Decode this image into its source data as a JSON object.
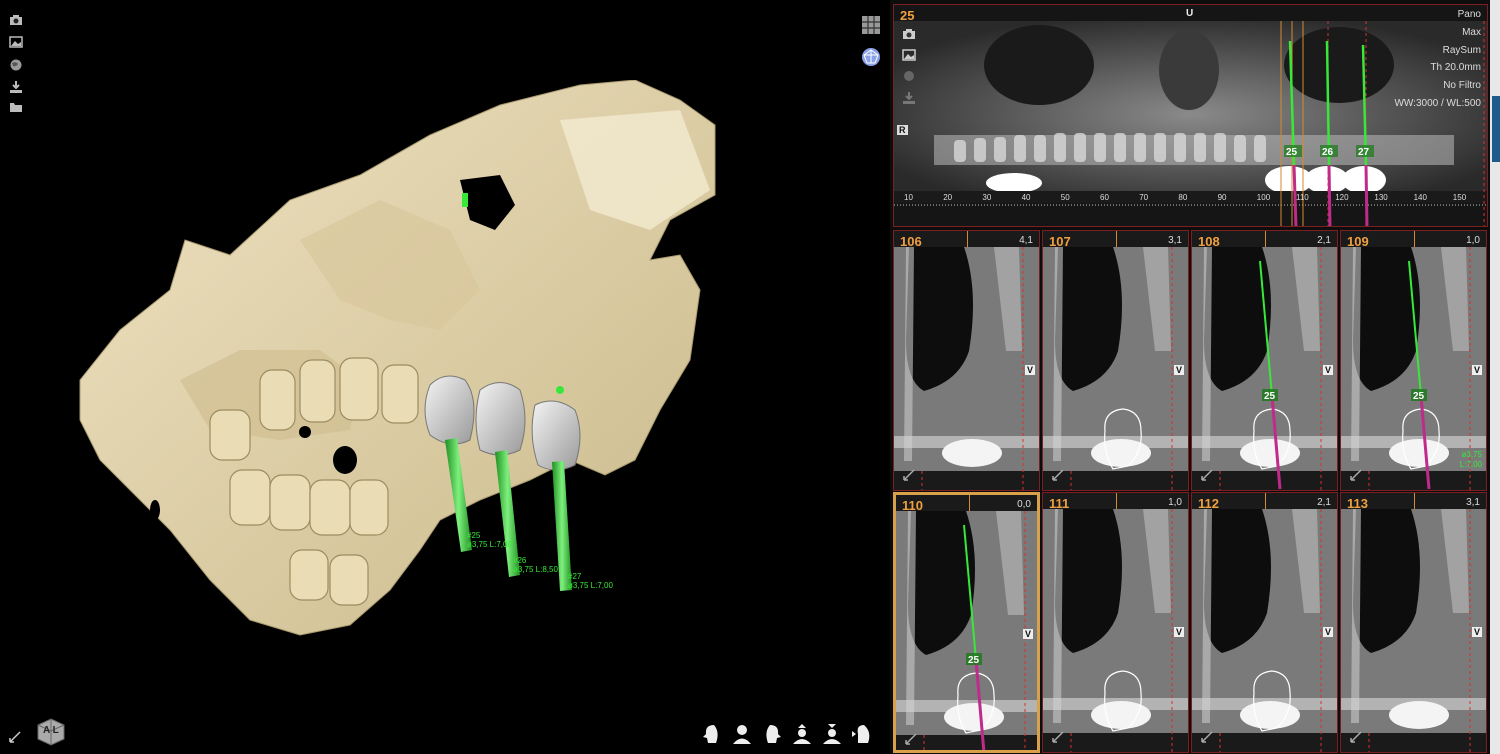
{
  "panorama": {
    "number": "25",
    "orientation_label": "U",
    "side_label": "R",
    "info": [
      "Pano",
      "Max",
      "RaySum",
      "Th 20.0mm",
      "No Filtro",
      "WW:3000 / WL:500"
    ],
    "ruler_ticks": [
      "10",
      "20",
      "30",
      "40",
      "50",
      "60",
      "70",
      "80",
      "90",
      "100",
      "110",
      "120",
      "130",
      "140",
      "150",
      "16"
    ],
    "implants": [
      "25",
      "26",
      "27"
    ]
  },
  "cross_sections": [
    {
      "number": "106",
      "value": "4,1",
      "view": "V",
      "implant": ""
    },
    {
      "number": "107",
      "value": "3,1",
      "view": "V",
      "implant": ""
    },
    {
      "number": "108",
      "value": "2,1",
      "view": "V",
      "implant": "25"
    },
    {
      "number": "109",
      "value": "1,0",
      "view": "V",
      "implant": "25",
      "detail": [
        "ø3,75",
        "L:7,00"
      ]
    },
    {
      "number": "110",
      "value": "0,0",
      "view": "V",
      "implant": "25"
    },
    {
      "number": "111",
      "value": "1,0",
      "view": "V",
      "implant": ""
    },
    {
      "number": "112",
      "value": "2,1",
      "view": "V",
      "implant": ""
    },
    {
      "number": "113",
      "value": "3,1",
      "view": "V",
      "implant": ""
    }
  ],
  "implant_labels_3d": [
    {
      "id": "#25",
      "spec": "ø3,75 L:7,00"
    },
    {
      "id": "#26",
      "spec": "ø3,75 L:8,50"
    },
    {
      "id": "#27",
      "spec": "ø3,75 L:7,00"
    }
  ],
  "orientation_cube": "A L",
  "icons": {
    "left_toolbar": [
      "camera-icon",
      "image-icon",
      "globe-icon",
      "download-icon",
      "folder-icon"
    ],
    "right_toolbar": [
      "mesh-grid-icon",
      "render-sphere-icon",
      "moon-icon"
    ],
    "bottom_toolbar": [
      "head-left-icon",
      "head-front-icon",
      "head-right-icon",
      "head-top-icon",
      "head-bottom-icon",
      "head-back-icon"
    ]
  },
  "colors": {
    "accent": "#f0a040",
    "implant": "#38e838",
    "bone": "#e3d4ad",
    "border": "#7b1f22"
  }
}
